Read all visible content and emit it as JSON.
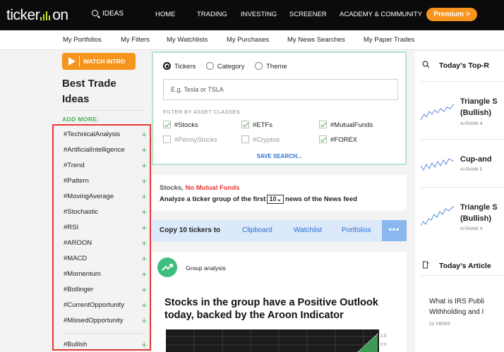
{
  "header": {
    "logo_text_left": "ticker",
    "logo_text_right": "on",
    "search_label": "IDEAS",
    "nav": [
      "HOME",
      "TRADING",
      "INVESTING",
      "SCREENER",
      "ACADEMY & COMMUNITY"
    ],
    "premium_label": "Premium >"
  },
  "subnav": [
    "My Portfolios",
    "My Filters",
    "My Watchlists",
    "My Purchases",
    "My News Searches",
    "My Paper Trades"
  ],
  "left": {
    "watch_intro": "WATCH INTRO",
    "title": "Best Trade Ideas",
    "add_more": "ADD MORE:",
    "tags": [
      "#TechnicalAnalysis",
      "#ArtificialIntelligence",
      "#Trend",
      "#Pattern",
      "#MovingAverage",
      "#Stochastic",
      "#RSI",
      "#AROON",
      "#MACD",
      "#Momentum",
      "#Bollinger",
      "#CurrentOpportunity",
      "#MissedOpportunity",
      "#Bullish"
    ]
  },
  "search": {
    "radios": [
      {
        "label": "Tickers",
        "selected": true
      },
      {
        "label": "Category",
        "selected": false
      },
      {
        "label": "Theme",
        "selected": false
      }
    ],
    "placeholder": "E.g. Tesla or TSLA",
    "filter_label": "FILTER BY ASSET CLASSES",
    "classes": [
      {
        "label": "#Stocks",
        "checked": true
      },
      {
        "label": "#ETFs",
        "checked": true
      },
      {
        "label": "#MutualFunds",
        "checked": true
      },
      {
        "label": "#PennyStocks",
        "checked": false
      },
      {
        "label": "#Cryptos",
        "checked": false
      },
      {
        "label": "#FOREX",
        "checked": true
      }
    ],
    "save_label": "SAVE SEARCH..."
  },
  "stocks": {
    "prefix": "Stocks, ",
    "highlight": "No Mutual Funds",
    "line2_a": "Analyze a ticker group of the first",
    "select_value": "10",
    "line2_b": "news of the News feed"
  },
  "copy": {
    "label": "Copy 10 tickers to",
    "targets": [
      "Clipboard",
      "Watchlist",
      "Portfolios"
    ],
    "more": "•••"
  },
  "group": {
    "label": "Group analysis",
    "title": "Stocks in the group have a Positive Outlook today, backed by the Aroon Indicator",
    "axis_ticks": [
      "2.5",
      "2.0"
    ]
  },
  "right": {
    "top_heading": "Today's Top-R",
    "ideas": [
      {
        "title1": "Triangle S",
        "title2": "(Bullish)",
        "rank": "AI RANK 4"
      },
      {
        "title1": "Cup-and",
        "title2": "",
        "rank": "AI RANK 5"
      },
      {
        "title1": "Triangle S",
        "title2": "(Bullish)",
        "rank": "AI RANK 4"
      }
    ],
    "articles_heading": "Today's Article",
    "article": {
      "line1": "What is IRS Publi",
      "line2": "Withholding and I",
      "views": "21 VIEWS"
    }
  },
  "colors": {
    "accent_orange": "#f7941d",
    "green": "#4caf50",
    "link_blue": "#2a6fd6",
    "highlight_red": "#e53935"
  }
}
